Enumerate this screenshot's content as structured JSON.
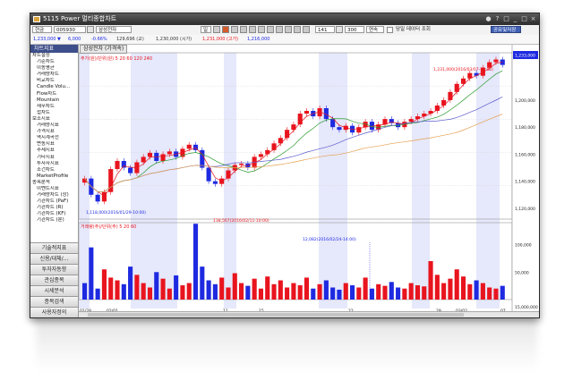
{
  "window": {
    "title": "5115 Power 멀티종합차트"
  },
  "toolbar": {
    "mode": "현금",
    "code": "005930",
    "name": "삼성전자",
    "period_label": "일",
    "count1": "141",
    "count2": "300",
    "continuous": "연속",
    "checkbox_label": "당일 데이터 조회",
    "share_button": "공유및저장"
  },
  "infobar": {
    "texts": [
      "1,233,000 ▼",
      "6,000",
      "-0.66%",
      "129,696 (교)",
      "1,230,000 (시가)",
      "1,231,000 (고가)",
      "1,216,000"
    ]
  },
  "sidebar": {
    "header": "차트지표",
    "items": [
      "차트설정",
      "기준차트",
      "이동평균",
      "거래량차트",
      "비교차트",
      "Candle Volu...",
      "Flow차트",
      "Mountain",
      "재무차트",
      "접차트",
      "보조지표",
      "거래량지표",
      "가격지표",
      "역시계곡선",
      "변동지표",
      "추세지표",
      "기타지표",
      "투자자지표",
      "조건차트",
      "MarketProfile",
      "종목분석",
      "이벤트지표",
      "거래량차트 (상)",
      "기관차트 (PaF)",
      "기관차트 (R)",
      "기관차트 (KF)",
      "기관차트 (분)"
    ],
    "buttons": [
      "기술적지표",
      "신용/대체/...",
      "투자자동향",
      "관심종목",
      "시세분석",
      "종목검색",
      "사용자정의"
    ]
  },
  "price_panel": {
    "tab": "삼성전자 (가격속)",
    "legend": "주가(원)/단위(원) 5 20 60 120 240",
    "high_note": "1,231,000(2016/03/07-13:00)",
    "low_note": "1,118,000(2016/01/29-10:00)"
  },
  "volume_panel": {
    "legend": "거래량(주)/단위(주) 5 20 60",
    "peak_note": "138,567(2016/02/11-10:00)",
    "mid_note": "12,082(2016/02/24-14:00)"
  },
  "price_axis": [
    "1,200,000",
    "1,180,000",
    "1,160,000",
    "1,140,000",
    "1,120,000"
  ],
  "current_price": "1,233,000",
  "volume_axis": [
    "100,000",
    "50,000",
    "15,000,000"
  ],
  "date_axis": [
    "01/28",
    "02/01",
    "11",
    "15",
    "22",
    "29",
    "03/02",
    "07"
  ],
  "colors": {
    "up": "#e8141e",
    "down": "#1e2ae0",
    "shade": "#e6e8fb",
    "ma5": "#e8141e",
    "ma20": "#2a9a2a",
    "ma60": "#5a5acc",
    "ma120": "#e6a050"
  }
}
